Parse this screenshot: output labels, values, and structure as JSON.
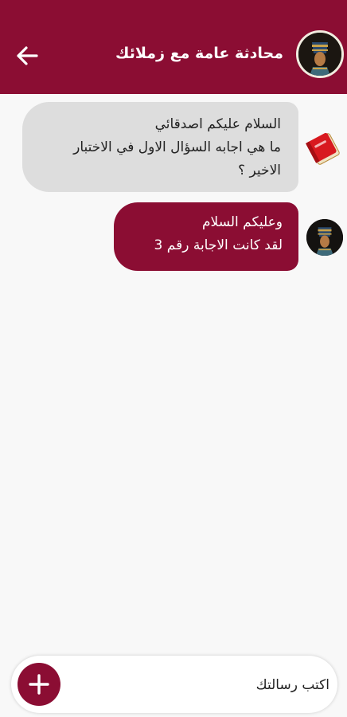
{
  "header": {
    "title": "محادثة عامة مع زملائك",
    "back_icon": "arrow-back-icon",
    "avatar_icon": "nefertiti-avatar"
  },
  "messages": [
    {
      "direction": "incoming",
      "avatar_icon": "red-book-icon",
      "lines": [
        "السلام عليكم اصدقائي",
        "ما هي اجابه السؤال الاول في الاختبار",
        "الاخير ؟"
      ]
    },
    {
      "direction": "outgoing",
      "avatar_icon": "nefertiti-avatar",
      "lines": [
        "وعليكم السلام",
        "لقد كانت الاجابة رقم 3"
      ]
    }
  ],
  "composer": {
    "placeholder": "اكتب رسالتك",
    "add_icon": "plus-icon"
  },
  "colors": {
    "primary": "#8b0d33",
    "incoming_bubble": "#dddddd",
    "background": "#f8f8f8"
  }
}
